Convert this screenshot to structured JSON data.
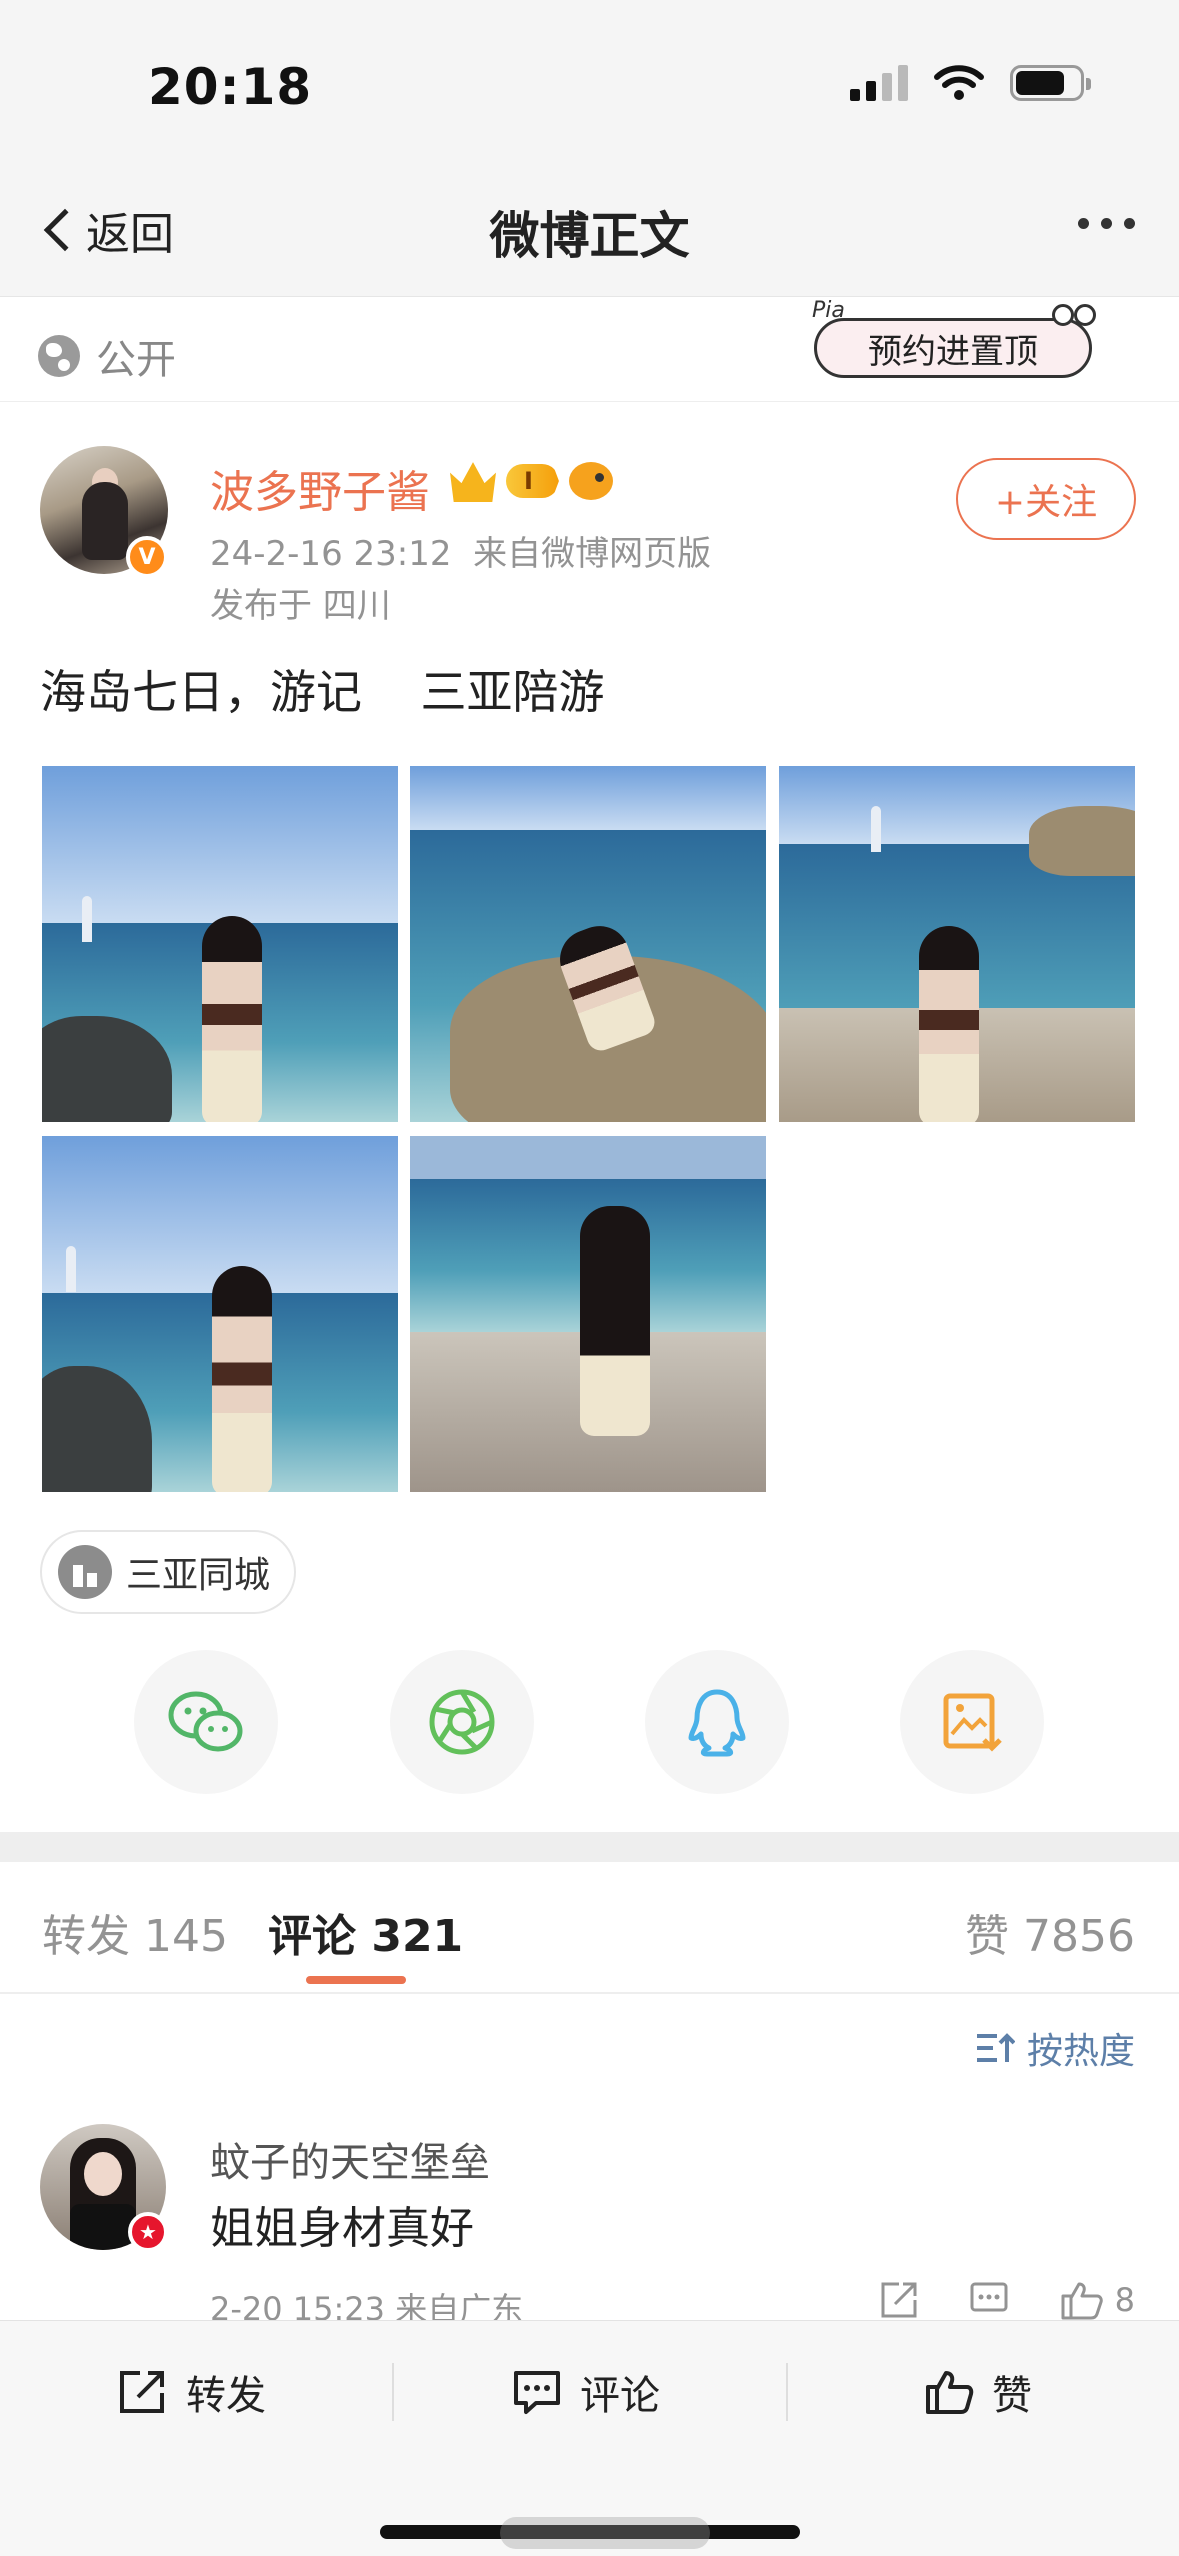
{
  "status_bar": {
    "time": "20:18"
  },
  "nav": {
    "back_label": "返回",
    "title": "微博正文"
  },
  "visibility": {
    "label": "公开",
    "pin_label": "预约进置顶",
    "pin_small": "Pia"
  },
  "post": {
    "username": "波多野子酱",
    "level_badge": "I",
    "timestamp": "24-2-16 23:12",
    "source": "来自微博网页版",
    "location_line": "发布于 四川",
    "follow_label": "+关注",
    "text": "海岛七日，游记    三亚陪游",
    "photos": [
      {
        "alt": "photo-1"
      },
      {
        "alt": "photo-2"
      },
      {
        "alt": "photo-3"
      },
      {
        "alt": "photo-4"
      },
      {
        "alt": "photo-5"
      }
    ],
    "location_chip": "三亚同城"
  },
  "share": [
    "wechat-icon",
    "moments-icon",
    "qq-icon",
    "save-image-icon"
  ],
  "tabs": {
    "repost_label": "转发",
    "repost_count": "145",
    "comment_label": "评论",
    "comment_count": "321",
    "like_label": "赞",
    "like_count": "7856"
  },
  "sort_label": "按热度",
  "comments": [
    {
      "user": "蚊子的天空堡垒",
      "text": "姐姐身材真好",
      "meta": "2-20 15:23  来自广东",
      "likes": "8"
    }
  ],
  "bottom_bar": {
    "repost": "转发",
    "comment": "评论",
    "like": "赞"
  },
  "colors": {
    "accent": "#eb7350",
    "link": "#5d7fa8"
  }
}
